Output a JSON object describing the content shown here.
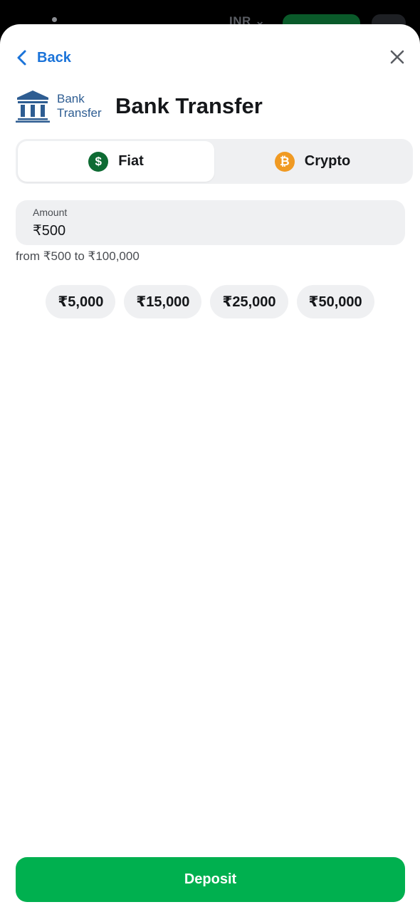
{
  "underlay": {
    "currency": "INR"
  },
  "nav": {
    "back_label": "Back"
  },
  "header": {
    "logo_text_line1": "Bank",
    "logo_text_line2": "Transfer",
    "title": "Bank Transfer"
  },
  "tabs": [
    {
      "label": "Fiat",
      "icon": "dollar-coin-icon",
      "icon_glyph": "$",
      "active": true
    },
    {
      "label": "Crypto",
      "icon": "bitcoin-icon",
      "icon_glyph": "₿",
      "active": false
    }
  ],
  "amount": {
    "label": "Amount",
    "value": "₹500",
    "range_text": "from ₹500 to ₹100,000"
  },
  "quick_amounts": [
    "₹5,000",
    "₹15,000",
    "₹25,000",
    "₹50,000"
  ],
  "deposit_label": "Deposit",
  "colors": {
    "accent_blue": "#1a73d9",
    "deposit_green": "#00b04f",
    "fiat_green": "#0e6b33",
    "bitcoin_orange": "#f09a23",
    "logo_blue": "#2e5d92"
  }
}
